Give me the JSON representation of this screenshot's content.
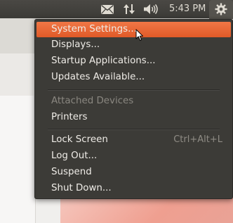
{
  "panel": {
    "clock": "5:43 PM",
    "icons": [
      "mail-icon",
      "network-icon",
      "volume-icon",
      "gear-icon"
    ]
  },
  "menu": {
    "items": [
      {
        "label": "System Settings...",
        "active": true
      },
      {
        "label": "Displays..."
      },
      {
        "label": "Startup Applications..."
      },
      {
        "label": "Updates Available..."
      },
      {
        "label": "Attached Devices",
        "disabled": true
      },
      {
        "label": "Printers"
      },
      {
        "label": "Lock Screen",
        "shortcut": "Ctrl+Alt+L"
      },
      {
        "label": "Log Out..."
      },
      {
        "label": "Suspend"
      },
      {
        "label": "Shut Down..."
      }
    ]
  },
  "colors": {
    "panel": "#3c3b37",
    "menu_bg": "#3c3b37",
    "highlight": "#e8602e",
    "text": "#efece7"
  }
}
